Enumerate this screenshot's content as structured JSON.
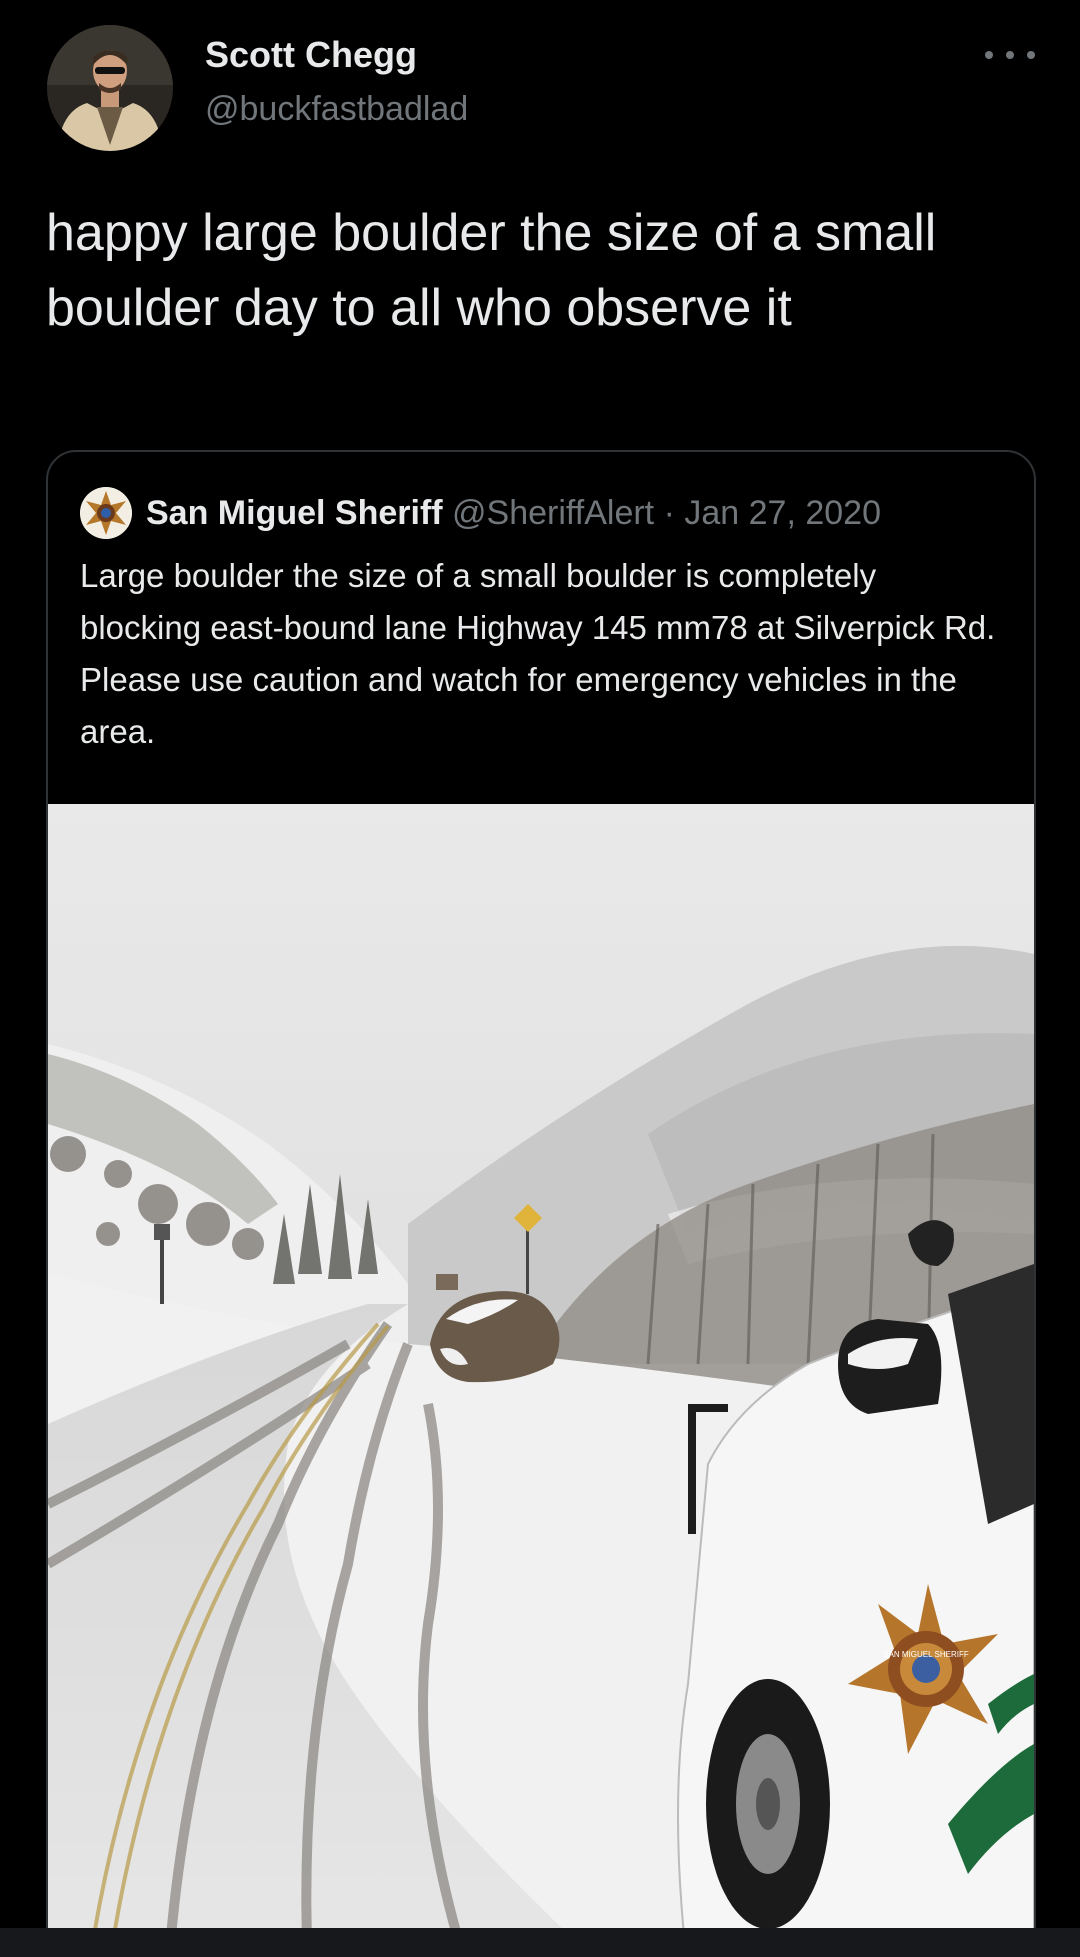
{
  "tweet": {
    "author": {
      "display_name": "Scott Chegg",
      "handle": "@buckfastbadlad",
      "avatar_icon": "person-avatar-icon"
    },
    "more_icon": "more-horizontal-icon",
    "text": "happy large boulder the size of a small boulder day to all who observe it"
  },
  "quoted_tweet": {
    "author": {
      "display_name": "San Miguel Sheriff",
      "handle": "@SheriffAlert",
      "avatar_icon": "sheriff-badge-icon"
    },
    "separator": "·",
    "date": "Jan 27, 2020",
    "text": "Large boulder the size of a small boulder is completely blocking east-bound lane Highway 145 mm78 at Silverpick Rd. Please use caution and watch for emergency vehicles in the area.",
    "media": {
      "type": "photo",
      "badge_text": "SAN MIGUEL SHERIFF"
    }
  },
  "colors": {
    "background": "#000000",
    "text_primary": "#e7e9ea",
    "text_secondary": "#71767b",
    "border": "#2f3336"
  }
}
